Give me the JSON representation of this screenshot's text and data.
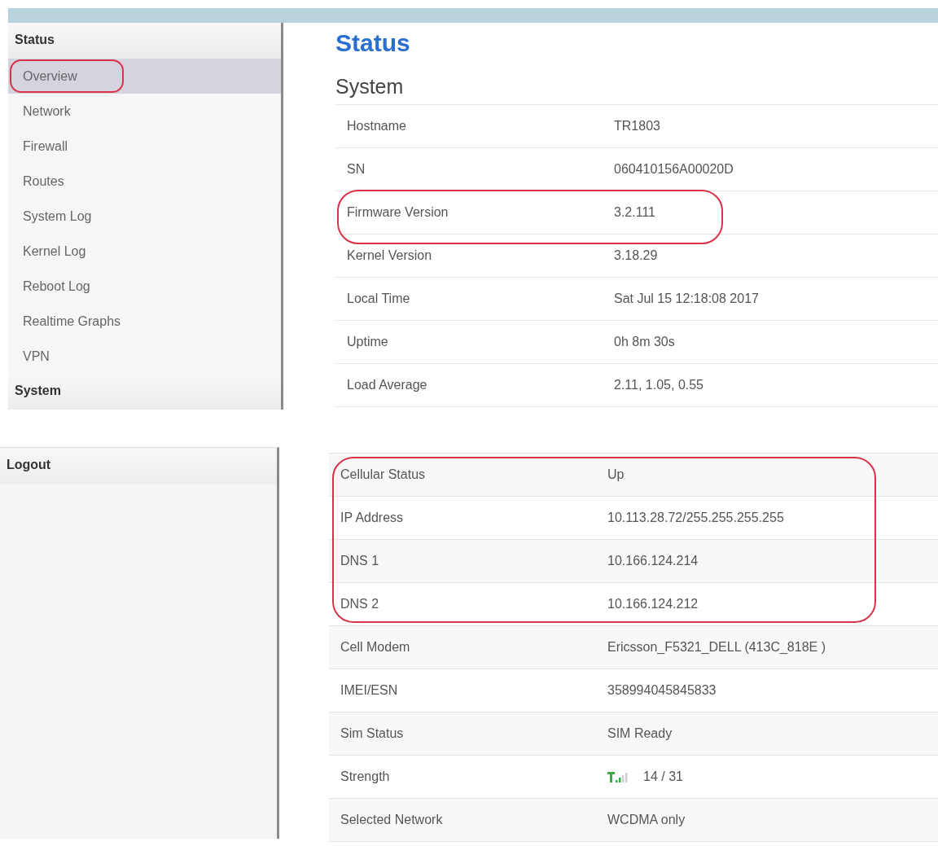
{
  "sidebar": {
    "sections": [
      {
        "title": "Status",
        "items": [
          {
            "label": "Overview",
            "selected": true,
            "circled": true
          },
          {
            "label": "Network",
            "selected": false,
            "circled": false
          },
          {
            "label": "Firewall",
            "selected": false,
            "circled": false
          },
          {
            "label": "Routes",
            "selected": false,
            "circled": false
          },
          {
            "label": "System Log",
            "selected": false,
            "circled": false
          },
          {
            "label": "Kernel Log",
            "selected": false,
            "circled": false
          },
          {
            "label": "Reboot Log",
            "selected": false,
            "circled": false
          },
          {
            "label": "Realtime Graphs",
            "selected": false,
            "circled": false
          },
          {
            "label": "VPN",
            "selected": false,
            "circled": false
          }
        ]
      },
      {
        "title": "System"
      }
    ],
    "logout": "Logout"
  },
  "page_title": "Status",
  "section_title": "System",
  "system_table": [
    {
      "label": "Hostname",
      "value": "TR1803",
      "circled": false
    },
    {
      "label": "SN",
      "value": "060410156A00020D",
      "circled": false
    },
    {
      "label": "Firmware Version",
      "value": "3.2.111",
      "circled": true
    },
    {
      "label": "Kernel Version",
      "value": "3.18.29",
      "circled": false
    },
    {
      "label": "Local Time",
      "value": "Sat Jul 15 12:18:08 2017",
      "circled": false
    },
    {
      "label": "Uptime",
      "value": "0h 8m 30s",
      "circled": false
    },
    {
      "label": "Load Average",
      "value": "2.11, 1.05, 0.55",
      "circled": false
    }
  ],
  "cellular_table": [
    {
      "label": "Cellular Status",
      "value": "Up",
      "circled": true,
      "kind": "text"
    },
    {
      "label": "IP Address",
      "value": "10.113.28.72/255.255.255.255",
      "circled": true,
      "kind": "text"
    },
    {
      "label": "DNS 1",
      "value": "10.166.124.214",
      "circled": true,
      "kind": "text"
    },
    {
      "label": "DNS 2",
      "value": "10.166.124.212",
      "circled": true,
      "kind": "text"
    },
    {
      "label": "Cell Modem",
      "value": "Ericsson_F5321_DELL (413C_818E )",
      "circled": false,
      "kind": "text"
    },
    {
      "label": "IMEI/ESN",
      "value": "358994045845833",
      "circled": false,
      "kind": "text"
    },
    {
      "label": "Sim Status",
      "value": "SIM Ready",
      "circled": false,
      "kind": "text"
    },
    {
      "label": "Strength",
      "value": "14 / 31",
      "circled": false,
      "kind": "signal"
    },
    {
      "label": "Selected Network",
      "value": "WCDMA only",
      "circled": false,
      "kind": "text"
    }
  ]
}
